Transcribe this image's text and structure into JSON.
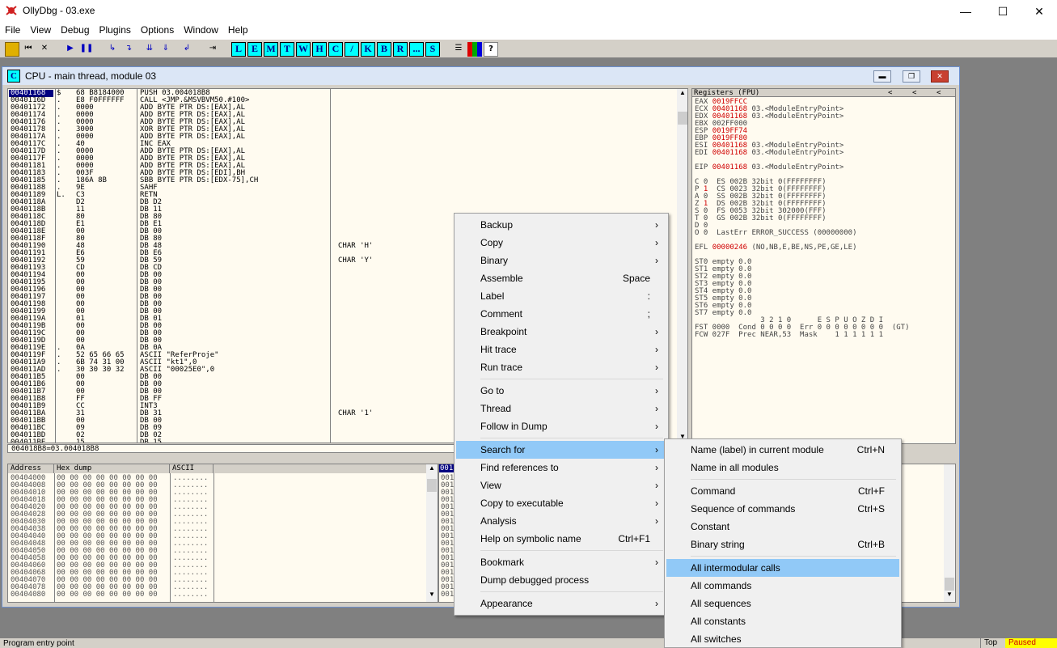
{
  "window": {
    "title": "OllyDbg - 03.exe",
    "minimize": "—",
    "maximize": "☐",
    "close": "✕"
  },
  "menubar": [
    "File",
    "View",
    "Debug",
    "Plugins",
    "Options",
    "Window",
    "Help"
  ],
  "toolbar": {
    "letters": [
      "L",
      "E",
      "M",
      "T",
      "W",
      "H",
      "C",
      "/",
      "K",
      "B",
      "R",
      "...",
      "S"
    ]
  },
  "cpu": {
    "title": "CPU - main thread, module 03",
    "icon_letter": "C"
  },
  "disasm_rows": [
    {
      "a": "00401168",
      "m": "$",
      "h": "68 B8184000",
      "i": "PUSH 03.004018B8",
      "c": ""
    },
    {
      "a": "0040116D",
      "m": ".",
      "h": "E8 F0FFFFFF",
      "i": "CALL <JMP.&MSVBVM50.#100>",
      "c": ""
    },
    {
      "a": "00401172",
      "m": ".",
      "h": "0000",
      "i": "ADD BYTE PTR DS:[EAX],AL",
      "c": ""
    },
    {
      "a": "00401174",
      "m": ".",
      "h": "0000",
      "i": "ADD BYTE PTR DS:[EAX],AL",
      "c": ""
    },
    {
      "a": "00401176",
      "m": ".",
      "h": "0000",
      "i": "ADD BYTE PTR DS:[EAX],AL",
      "c": ""
    },
    {
      "a": "00401178",
      "m": ".",
      "h": "3000",
      "i": "XOR BYTE PTR DS:[EAX],AL",
      "c": ""
    },
    {
      "a": "0040117A",
      "m": ".",
      "h": "0000",
      "i": "ADD BYTE PTR DS:[EAX],AL",
      "c": ""
    },
    {
      "a": "0040117C",
      "m": ".",
      "h": "40",
      "i": "INC EAX",
      "c": ""
    },
    {
      "a": "0040117D",
      "m": ".",
      "h": "0000",
      "i": "ADD BYTE PTR DS:[EAX],AL",
      "c": ""
    },
    {
      "a": "0040117F",
      "m": ".",
      "h": "0000",
      "i": "ADD BYTE PTR DS:[EAX],AL",
      "c": ""
    },
    {
      "a": "00401181",
      "m": ".",
      "h": "0000",
      "i": "ADD BYTE PTR DS:[EAX],AL",
      "c": ""
    },
    {
      "a": "00401183",
      "m": ".",
      "h": "003F",
      "i": "ADD BYTE PTR DS:[EDI],BH",
      "c": ""
    },
    {
      "a": "00401185",
      "m": ".",
      "h": "186A 8B",
      "i": "SBB BYTE PTR DS:[EDX-75],CH",
      "c": ""
    },
    {
      "a": "00401188",
      "m": ".",
      "h": "9E",
      "i": "SAHF",
      "c": ""
    },
    {
      "a": "00401189",
      "m": "L.",
      "h": "C3",
      "i": "RETN",
      "c": ""
    },
    {
      "a": "0040118A",
      "m": "",
      "h": "D2",
      "i": "DB D2",
      "c": ""
    },
    {
      "a": "0040118B",
      "m": "",
      "h": "11",
      "i": "DB 11",
      "c": ""
    },
    {
      "a": "0040118C",
      "m": "",
      "h": "80",
      "i": "DB 80",
      "c": ""
    },
    {
      "a": "0040118D",
      "m": "",
      "h": "E1",
      "i": "DB E1",
      "c": ""
    },
    {
      "a": "0040118E",
      "m": "",
      "h": "00",
      "i": "DB 00",
      "c": ""
    },
    {
      "a": "0040118F",
      "m": "",
      "h": "80",
      "i": "DB 80",
      "c": ""
    },
    {
      "a": "00401190",
      "m": "",
      "h": "48",
      "i": "DB 48",
      "c": "CHAR 'H'"
    },
    {
      "a": "00401191",
      "m": "",
      "h": "E6",
      "i": "DB E6",
      "c": ""
    },
    {
      "a": "00401192",
      "m": "",
      "h": "59",
      "i": "DB 59",
      "c": "CHAR 'Y'"
    },
    {
      "a": "00401193",
      "m": "",
      "h": "CD",
      "i": "DB CD",
      "c": ""
    },
    {
      "a": "00401194",
      "m": "",
      "h": "00",
      "i": "DB 00",
      "c": ""
    },
    {
      "a": "00401195",
      "m": "",
      "h": "00",
      "i": "DB 00",
      "c": ""
    },
    {
      "a": "00401196",
      "m": "",
      "h": "00",
      "i": "DB 00",
      "c": ""
    },
    {
      "a": "00401197",
      "m": "",
      "h": "00",
      "i": "DB 00",
      "c": ""
    },
    {
      "a": "00401198",
      "m": "",
      "h": "00",
      "i": "DB 00",
      "c": ""
    },
    {
      "a": "00401199",
      "m": "",
      "h": "00",
      "i": "DB 00",
      "c": ""
    },
    {
      "a": "0040119A",
      "m": "",
      "h": "01",
      "i": "DB 01",
      "c": ""
    },
    {
      "a": "0040119B",
      "m": "",
      "h": "00",
      "i": "DB 00",
      "c": ""
    },
    {
      "a": "0040119C",
      "m": "",
      "h": "00",
      "i": "DB 00",
      "c": ""
    },
    {
      "a": "0040119D",
      "m": "",
      "h": "00",
      "i": "DB 00",
      "c": ""
    },
    {
      "a": "0040119E",
      "m": ".",
      "h": "0A",
      "i": "DB 0A",
      "c": ""
    },
    {
      "a": "0040119F",
      "m": ".",
      "h": "52 65 66 65",
      "i": "ASCII \"ReferProje\"",
      "c": ""
    },
    {
      "a": "004011A9",
      "m": ".",
      "h": "6B 74 31 00",
      "i": "ASCII \"kt1\",0",
      "c": ""
    },
    {
      "a": "004011AD",
      "m": ".",
      "h": "30 30 30 32",
      "i": "ASCII \"00025E0\",0",
      "c": ""
    },
    {
      "a": "004011B5",
      "m": "",
      "h": "00",
      "i": "DB 00",
      "c": ""
    },
    {
      "a": "004011B6",
      "m": "",
      "h": "00",
      "i": "DB 00",
      "c": ""
    },
    {
      "a": "004011B7",
      "m": "",
      "h": "00",
      "i": "DB 00",
      "c": ""
    },
    {
      "a": "004011B8",
      "m": "",
      "h": "FF",
      "i": "DB FF",
      "c": ""
    },
    {
      "a": "004011B9",
      "m": "",
      "h": "CC",
      "i": "INT3",
      "c": ""
    },
    {
      "a": "004011BA",
      "m": "",
      "h": "31",
      "i": "DB 31",
      "c": "CHAR '1'"
    },
    {
      "a": "004011BB",
      "m": "",
      "h": "00",
      "i": "DB 00",
      "c": ""
    },
    {
      "a": "004011BC",
      "m": "",
      "h": "09",
      "i": "DB 09",
      "c": ""
    },
    {
      "a": "004011BD",
      "m": "",
      "h": "02",
      "i": "DB 02",
      "c": ""
    },
    {
      "a": "004011BE",
      "m": "",
      "h": "15",
      "i": "DB 15",
      "c": ""
    }
  ],
  "disasm_status": "004018B8=03.004018B8",
  "registers": {
    "header": "Registers (FPU)",
    "lines": [
      {
        "t": "EAX ",
        "v": "0019FFCC",
        "r": ""
      },
      {
        "t": "ECX ",
        "v": "00401168",
        "r": " 03.<ModuleEntryPoint>"
      },
      {
        "t": "EDX ",
        "v": "00401168",
        "r": " 03.<ModuleEntryPoint>"
      },
      {
        "t": "EBX ",
        "v": "",
        "r": "002FF000"
      },
      {
        "t": "ESP ",
        "v": "0019FF74",
        "r": ""
      },
      {
        "t": "EBP ",
        "v": "0019FF80",
        "r": ""
      },
      {
        "t": "ESI ",
        "v": "00401168",
        "r": " 03.<ModuleEntryPoint>"
      },
      {
        "t": "EDI ",
        "v": "00401168",
        "r": " 03.<ModuleEntryPoint>"
      },
      {
        "t": "",
        "v": "",
        "r": ""
      },
      {
        "t": "EIP ",
        "v": "00401168",
        "r": " 03.<ModuleEntryPoint>"
      },
      {
        "t": "",
        "v": "",
        "r": ""
      },
      {
        "t": "C 0  ES 002B 32bit 0(FFFFFFFF)",
        "v": "",
        "r": ""
      },
      {
        "t": "P ",
        "v": "1",
        "r": "  CS 0023 32bit 0(FFFFFFFF)"
      },
      {
        "t": "A 0  SS 002B 32bit 0(FFFFFFFF)",
        "v": "",
        "r": ""
      },
      {
        "t": "Z ",
        "v": "1",
        "r": "  DS 002B 32bit 0(FFFFFFFF)"
      },
      {
        "t": "S 0  FS 0053 32bit 302000(FFF)",
        "v": "",
        "r": ""
      },
      {
        "t": "T 0  GS 002B 32bit 0(FFFFFFFF)",
        "v": "",
        "r": ""
      },
      {
        "t": "D 0",
        "v": "",
        "r": ""
      },
      {
        "t": "O 0  LastErr ERROR_SUCCESS (00000000)",
        "v": "",
        "r": ""
      },
      {
        "t": "",
        "v": "",
        "r": ""
      },
      {
        "t": "EFL ",
        "v": "00000246",
        "r": " (NO,NB,E,BE,NS,PE,GE,LE)"
      },
      {
        "t": "",
        "v": "",
        "r": ""
      },
      {
        "t": "ST0 empty 0.0",
        "v": "",
        "r": ""
      },
      {
        "t": "ST1 empty 0.0",
        "v": "",
        "r": ""
      },
      {
        "t": "ST2 empty 0.0",
        "v": "",
        "r": ""
      },
      {
        "t": "ST3 empty 0.0",
        "v": "",
        "r": ""
      },
      {
        "t": "ST4 empty 0.0",
        "v": "",
        "r": ""
      },
      {
        "t": "ST5 empty 0.0",
        "v": "",
        "r": ""
      },
      {
        "t": "ST6 empty 0.0",
        "v": "",
        "r": ""
      },
      {
        "t": "ST7 empty 0.0",
        "v": "",
        "r": ""
      },
      {
        "t": "               3 2 1 0      E S P U O Z D I",
        "v": "",
        "r": ""
      },
      {
        "t": "FST 0000  Cond 0 0 0 0  Err 0 0 0 0 0 0 0 0  (GT)",
        "v": "",
        "r": ""
      },
      {
        "t": "FCW 027F  Prec NEAR,53  Mask    1 1 1 1 1 1",
        "v": "",
        "r": ""
      }
    ]
  },
  "dump": {
    "headers": [
      "Address",
      "Hex dump",
      "ASCII"
    ],
    "rows": [
      "00404000",
      "00404008",
      "00404010",
      "00404018",
      "00404020",
      "00404028",
      "00404030",
      "00404038",
      "00404040",
      "00404048",
      "00404050",
      "00404058",
      "00404060",
      "00404068",
      "00404070",
      "00404078",
      "00404080"
    ],
    "hex": "00 00 00 00 00 00 00 00",
    "ascii": "........"
  },
  "stack": {
    "header": "001",
    "rows": [
      "001",
      "001",
      "001",
      "001",
      "001",
      "001",
      "001",
      "001",
      "001",
      "001",
      "001",
      "001",
      "001",
      "001",
      "001",
      "001",
      "001"
    ]
  },
  "statusbar": {
    "left": "Program entry point",
    "top": "Top",
    "paused": "Paused"
  },
  "context_menu": [
    {
      "label": "Backup",
      "key": "",
      "sub": true
    },
    {
      "label": "Copy",
      "key": "",
      "sub": true
    },
    {
      "label": "Binary",
      "key": "",
      "sub": true
    },
    {
      "label": "Assemble",
      "key": "Space",
      "sub": false
    },
    {
      "label": "Label",
      "key": ":",
      "sub": false
    },
    {
      "label": "Comment",
      "key": ";",
      "sub": false
    },
    {
      "label": "Breakpoint",
      "key": "",
      "sub": true
    },
    {
      "label": "Hit trace",
      "key": "",
      "sub": true
    },
    {
      "label": "Run trace",
      "key": "",
      "sub": true
    },
    {
      "sep": true
    },
    {
      "label": "Go to",
      "key": "",
      "sub": true
    },
    {
      "label": "Thread",
      "key": "",
      "sub": true
    },
    {
      "label": "Follow in Dump",
      "key": "",
      "sub": true
    },
    {
      "sep": true
    },
    {
      "label": "Search for",
      "key": "",
      "sub": true,
      "hl": true
    },
    {
      "label": "Find references to",
      "key": "",
      "sub": true
    },
    {
      "label": "View",
      "key": "",
      "sub": true
    },
    {
      "label": "Copy to executable",
      "key": "",
      "sub": true
    },
    {
      "label": "Analysis",
      "key": "",
      "sub": true
    },
    {
      "label": "Help on symbolic name",
      "key": "Ctrl+F1",
      "sub": false
    },
    {
      "sep": true
    },
    {
      "label": "Bookmark",
      "key": "",
      "sub": true
    },
    {
      "label": "Dump debugged process",
      "key": "",
      "sub": false
    },
    {
      "sep": true
    },
    {
      "label": "Appearance",
      "key": "",
      "sub": true
    }
  ],
  "submenu": [
    {
      "label": "Name (label) in current module",
      "key": "Ctrl+N"
    },
    {
      "label": "Name in all modules",
      "key": ""
    },
    {
      "sep": true
    },
    {
      "label": "Command",
      "key": "Ctrl+F"
    },
    {
      "label": "Sequence of commands",
      "key": "Ctrl+S"
    },
    {
      "label": "Constant",
      "key": ""
    },
    {
      "label": "Binary string",
      "key": "Ctrl+B"
    },
    {
      "sep": true
    },
    {
      "label": "All intermodular calls",
      "key": "",
      "hl": true
    },
    {
      "label": "All commands",
      "key": ""
    },
    {
      "label": "All sequences",
      "key": ""
    },
    {
      "label": "All constants",
      "key": ""
    },
    {
      "label": "All switches",
      "key": ""
    }
  ]
}
